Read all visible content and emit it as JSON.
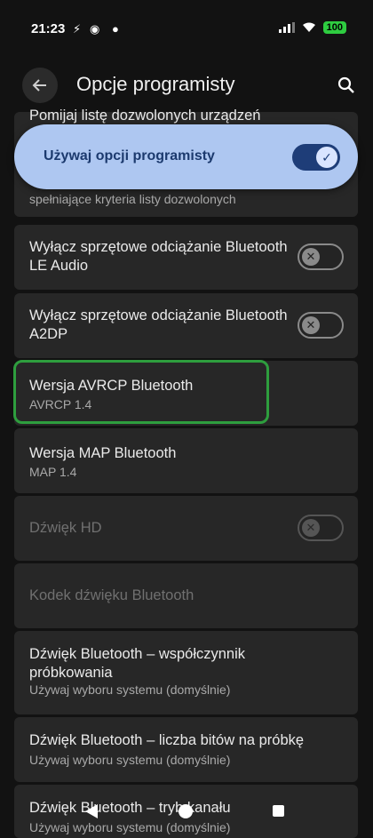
{
  "status_bar": {
    "time": "21:23",
    "battery": "100",
    "icons": [
      "flash-icon",
      "app-icon",
      "location-icon",
      "signal-icon",
      "wifi-icon",
      "battery-icon"
    ]
  },
  "appbar": {
    "title": "Opcje programisty",
    "back_icon": "arrow-back-icon",
    "search_icon": "search-icon"
  },
  "master_switch": {
    "label": "Używaj opcji programisty",
    "state": "on"
  },
  "settings": [
    {
      "label": "Pomijaj listę dozwolonych urządzeń",
      "sub": "spełniające kryteria listy dozwolonych"
    },
    {
      "label": "Wyłącz sprzętowe odciążanie Bluetooth LE Audio",
      "toggle": "off"
    },
    {
      "label": "Wyłącz sprzętowe odciążanie Bluetooth A2DP",
      "toggle": "off"
    },
    {
      "label": "Wersja AVRCP Bluetooth",
      "sub": "AVRCP 1.4"
    },
    {
      "label": "Wersja MAP Bluetooth",
      "sub": "MAP 1.4"
    },
    {
      "label": "Dźwięk HD",
      "toggle": "off",
      "disabled": true
    },
    {
      "label": "Kodek dźwięku Bluetooth",
      "disabled": true
    },
    {
      "label": "Dźwięk Bluetooth – współczynnik próbkowania",
      "sub": "Używaj wyboru systemu (domyślnie)"
    },
    {
      "label": "Dźwięk Bluetooth – liczba bitów na próbkę",
      "sub": "Używaj wyboru systemu (domyślnie)"
    },
    {
      "label": "Dźwięk Bluetooth – tryb kanału",
      "sub": "Używaj wyboru systemu (domyślnie)"
    }
  ],
  "colors": {
    "background": "#121212",
    "card": "#272727",
    "accent_banner": "#aec7f1",
    "toggle_on": "#1e3d78",
    "highlight": "#2e9e3e"
  }
}
